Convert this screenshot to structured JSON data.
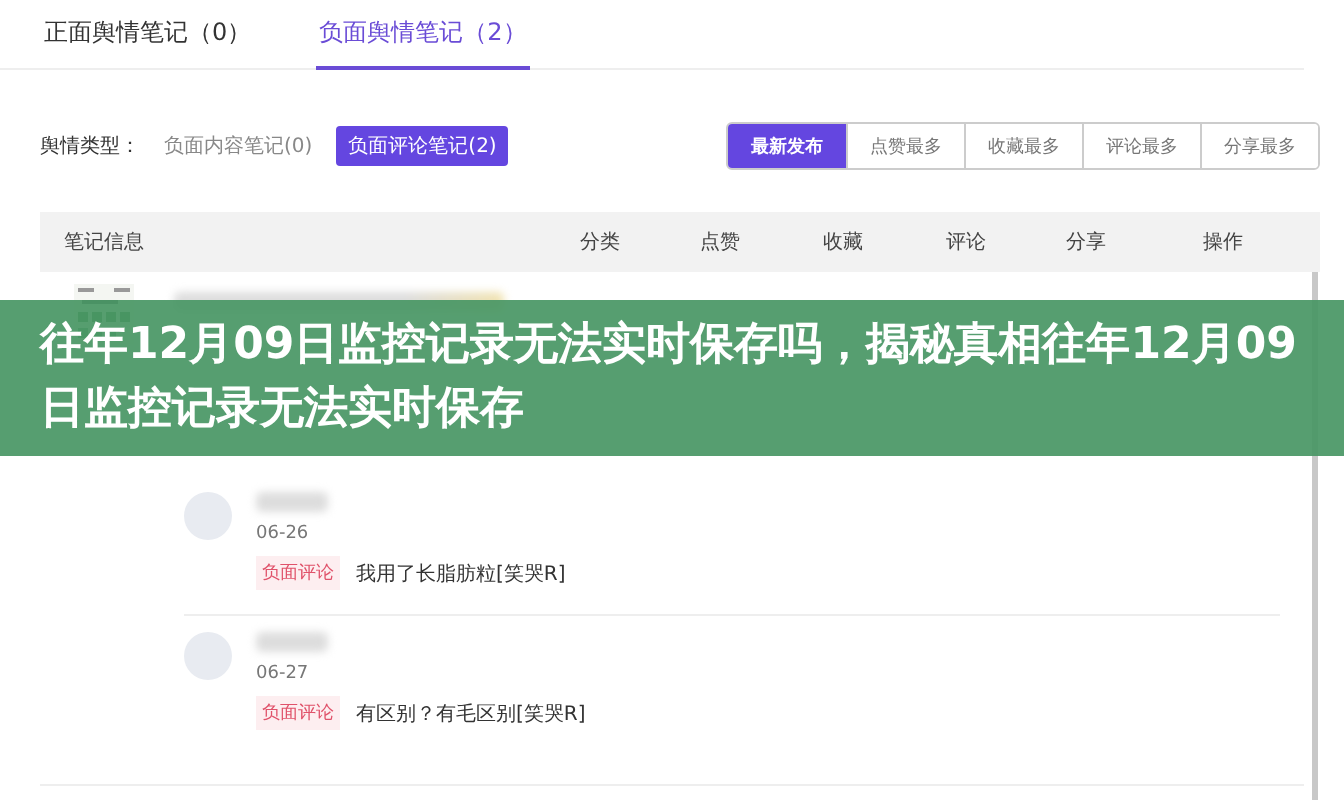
{
  "tabs": [
    {
      "label": "正面舆情笔记（0）",
      "selected": false
    },
    {
      "label": "负面舆情笔记（2）",
      "selected": true
    }
  ],
  "filter": {
    "label": "舆情类型：",
    "options": [
      {
        "label": "负面内容笔记(0)",
        "selected": false
      },
      {
        "label": "负面评论笔记(2)",
        "selected": true
      }
    ]
  },
  "sort_buttons": [
    {
      "label": "最新发布",
      "selected": true
    },
    {
      "label": "点赞最多",
      "selected": false
    },
    {
      "label": "收藏最多",
      "selected": false
    },
    {
      "label": "评论最多",
      "selected": false
    },
    {
      "label": "分享最多",
      "selected": false
    }
  ],
  "table": {
    "columns": [
      "笔记信息",
      "分类",
      "点赞",
      "收藏",
      "评论",
      "分享",
      "操作"
    ],
    "comments": [
      {
        "date": "06-26",
        "tag": "负面评论",
        "text": "我用了长脂肪粒[笑哭R]"
      },
      {
        "date": "06-27",
        "tag": "负面评论",
        "text": "有区别？有毛区别[笑哭R]"
      }
    ]
  },
  "banner": {
    "title": "往年12月09日监控记录无法实时保存吗，揭秘真相往年12月09日监控记录无法实时保存"
  }
}
